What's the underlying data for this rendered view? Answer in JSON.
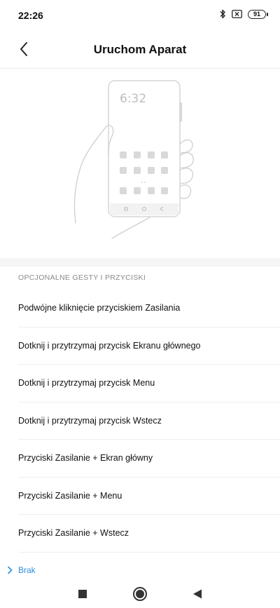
{
  "status_bar": {
    "time": "22:26",
    "battery_level": "91",
    "icons": [
      "bluetooth-icon",
      "sim-no-signal-icon",
      "battery-icon"
    ]
  },
  "header": {
    "title": "Uruchom Aparat",
    "back_icon": "chevron-left-icon"
  },
  "illustration": {
    "phone_clock": "6:32",
    "icons": [
      "hand-holding-phone-illustration"
    ]
  },
  "section": {
    "title": "OPCJONALNE GESTY I PRZYCISKI"
  },
  "gestures": [
    {
      "label": "Podwójne kliknięcie przyciskiem Zasilania"
    },
    {
      "label": "Dotknij i przytrzymaj przycisk Ekranu głównego"
    },
    {
      "label": "Dotknij i przytrzymaj przycisk Menu"
    },
    {
      "label": "Dotknij i przytrzymaj przycisk Wstecz"
    },
    {
      "label": "Przyciski Zasilanie + Ekran główny"
    },
    {
      "label": "Przyciski Zasilanie + Menu"
    },
    {
      "label": "Przyciski Zasilanie + Wstecz"
    }
  ],
  "selected_option": {
    "label": "Brak",
    "icon": "chevron-right-icon",
    "color": "#2a8ee0"
  },
  "nav_bar": {
    "icons": [
      "recents-square-icon",
      "home-circle-icon",
      "back-triangle-icon"
    ]
  }
}
